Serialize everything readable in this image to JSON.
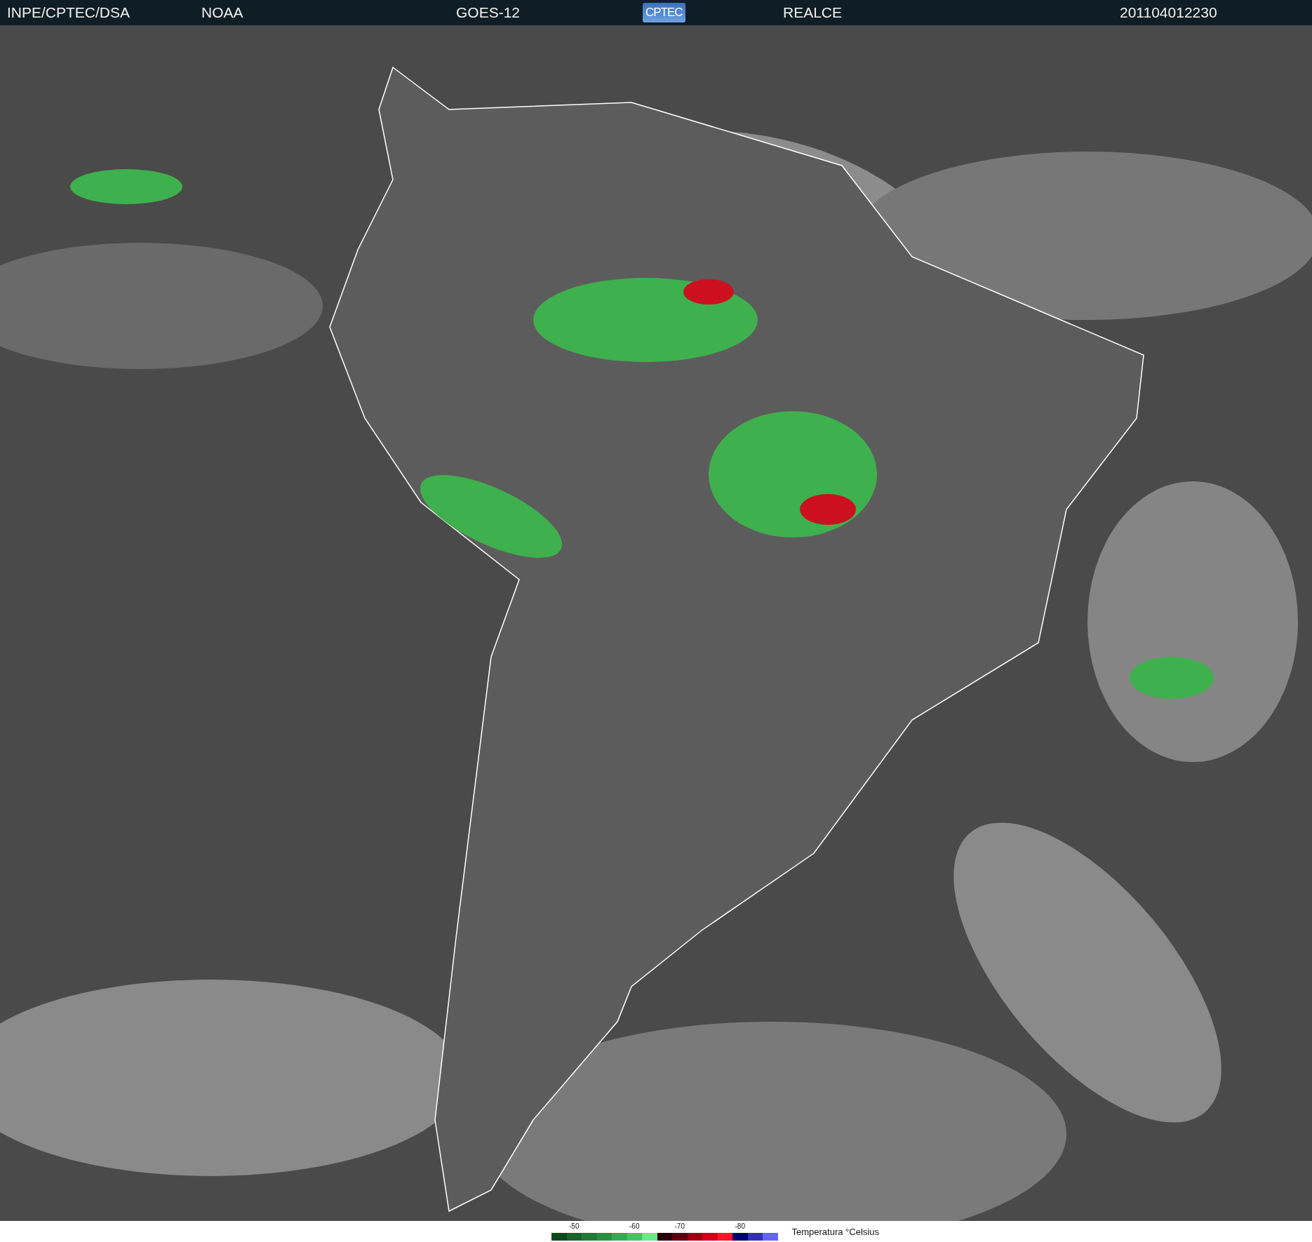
{
  "header": {
    "source": "INPE/CPTEC/DSA",
    "agency": "NOAA",
    "satellite": "GOES-12",
    "logo": "CPTEC",
    "product": "REALCE",
    "timestamp": "201104012230"
  },
  "legend": {
    "title": "Temperatura °Celsius",
    "swatches": [
      {
        "color": "#0b4a1c"
      },
      {
        "color": "#166328",
        "label": "-50"
      },
      {
        "color": "#1f7a33"
      },
      {
        "color": "#2a9040"
      },
      {
        "color": "#3aa850"
      },
      {
        "color": "#4cc060",
        "label": "-60"
      },
      {
        "color": "#6ee886"
      },
      {
        "color": "#2a0008"
      },
      {
        "color": "#5a0010",
        "label": "-70"
      },
      {
        "color": "#9a0012"
      },
      {
        "color": "#d00014"
      },
      {
        "color": "#ff1424"
      },
      {
        "color": "#00006a",
        "label": "-80"
      },
      {
        "color": "#3232b0"
      },
      {
        "color": "#6464f4"
      }
    ]
  }
}
